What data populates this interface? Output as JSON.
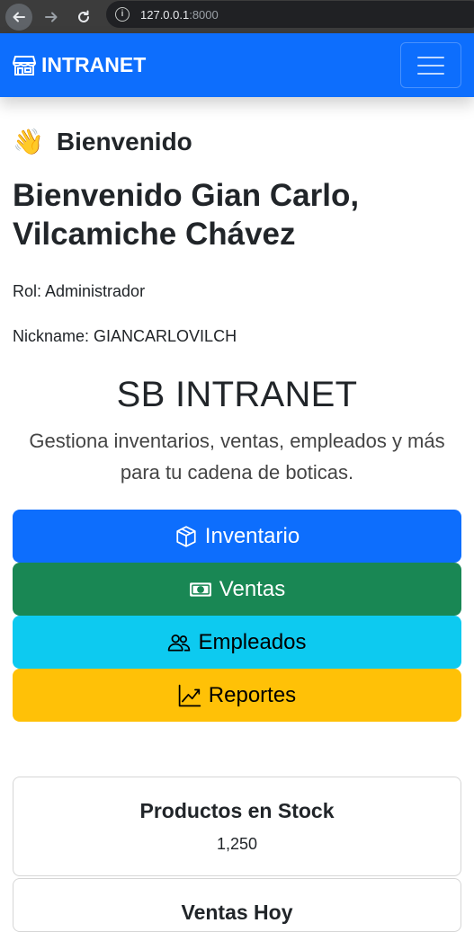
{
  "browser": {
    "url_host": "127.0.0.1",
    "url_port": ":8000"
  },
  "navbar": {
    "brand": "INTRANET"
  },
  "welcome": {
    "heading": "Bienvenido",
    "emoji": "👋",
    "greeting": "Bienvenido Gian Carlo, Vilcamiche Chávez",
    "rol": "Rol: Administrador",
    "nickname": "Nickname: GIANCARLOVILCH"
  },
  "hero": {
    "title": "SB INTRANET",
    "subtitle": "Gestiona inventarios, ventas, empleados y más para tu cadena de boticas."
  },
  "buttons": [
    {
      "label": "Inventario",
      "icon": "box-icon",
      "color": "#0d6efd"
    },
    {
      "label": "Ventas",
      "icon": "cash-icon",
      "color": "#198754"
    },
    {
      "label": "Empleados",
      "icon": "people-icon",
      "color": "#0dcaf0"
    },
    {
      "label": "Reportes",
      "icon": "chart-line-icon",
      "color": "#ffc107"
    }
  ],
  "cards": [
    {
      "title": "Productos en Stock",
      "value": "1,250"
    },
    {
      "title": "Ventas Hoy"
    }
  ]
}
